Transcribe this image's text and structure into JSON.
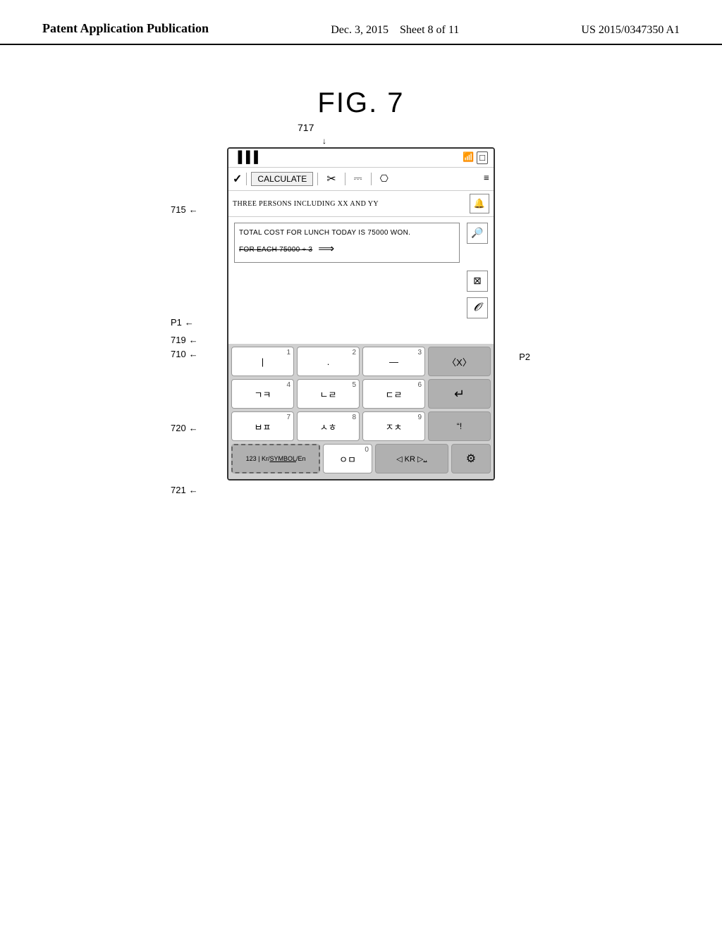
{
  "header": {
    "left": "Patent Application Publication",
    "center": "Dec. 3, 2015",
    "sheet": "Sheet 8 of 11",
    "right": "US 2015/0347350 A1"
  },
  "figure": {
    "label": "FIG. 7"
  },
  "diagram": {
    "label_717": "717",
    "label_715": "715",
    "label_p1": "P1",
    "label_p2": "P2",
    "label_719": "719",
    "label_710": "710",
    "label_720": "720",
    "label_721": "721",
    "status_bar": {
      "signal": "▐▐▐",
      "wifi": "📶",
      "battery": "🔋"
    },
    "toolbar": {
      "check": "✓",
      "calculate_btn": "CALCULATE",
      "scissors": "✂",
      "copy_icon": "❐",
      "paste_icon": "❑",
      "menu": "≡"
    },
    "message_bar": {
      "text": "THREE PERSONS INCLUDING XX AND YY",
      "icon": "🔔"
    },
    "content": {
      "line1": "TOTAL COST FOR LUNCH TODAY IS 75000 WON.",
      "line2_strikethrough": "FOR EACH 75000 ÷ 3",
      "arrow": "⟹"
    },
    "keyboard": {
      "row1": [
        {
          "main": "|",
          "num": "1"
        },
        {
          "main": ".",
          "num": "2"
        },
        {
          "main": "—",
          "num": "3"
        },
        {
          "main": "⌫",
          "num": "",
          "type": "dark"
        }
      ],
      "row2": [
        {
          "main": "ㄱㅋ",
          "num": "4"
        },
        {
          "main": "ㄴㄹ",
          "num": "5"
        },
        {
          "main": "ㄷㄹ",
          "num": "6"
        },
        {
          "main": "↵",
          "num": "",
          "type": "dark"
        }
      ],
      "row3": [
        {
          "main": "ㅂㅍ",
          "num": "7"
        },
        {
          "main": "ㅅㅎ",
          "num": "8"
        },
        {
          "main": "ㅈㅊ",
          "num": "9"
        },
        {
          "main": "\"!",
          "num": "",
          "type": "dark"
        }
      ],
      "row4_sym": "123 | Kr/\nSYMBOL /En",
      "row4_zero": {
        "main": "ㅇㅁ",
        "num": "0"
      },
      "row4_kr": "◁ KR ▷",
      "row4_gear": "⚙"
    }
  }
}
